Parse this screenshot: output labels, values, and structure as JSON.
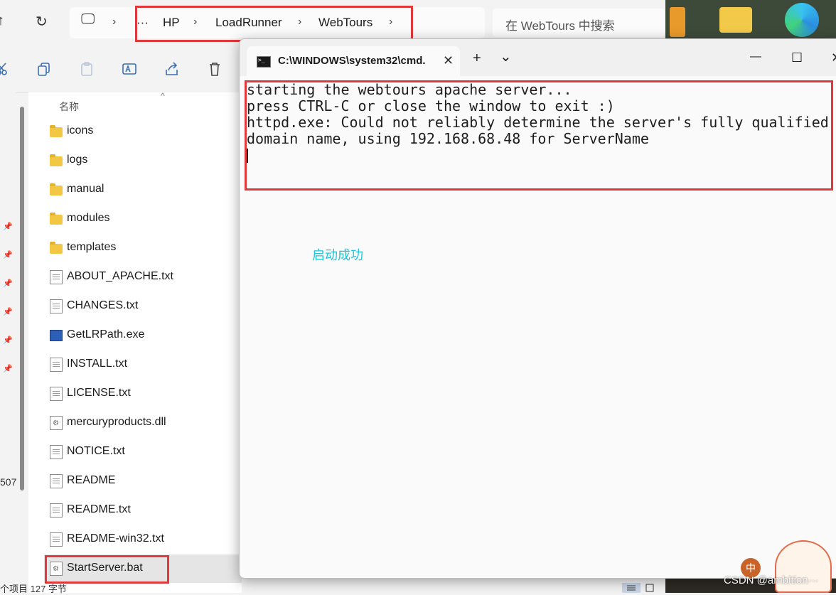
{
  "explorer": {
    "breadcrumb": {
      "more": "···",
      "items": [
        "HP",
        "LoadRunner",
        "WebTours"
      ]
    },
    "search_placeholder": "在 WebTours 中搜索",
    "toolbar_icons": [
      "cut-icon",
      "copy-icon",
      "paste-icon",
      "rename-icon",
      "share-icon",
      "delete-icon"
    ],
    "column_header": "名称",
    "files": [
      {
        "name": "icons",
        "type": "folder"
      },
      {
        "name": "logs",
        "type": "folder"
      },
      {
        "name": "manual",
        "type": "folder"
      },
      {
        "name": "modules",
        "type": "folder"
      },
      {
        "name": "templates",
        "type": "folder"
      },
      {
        "name": "ABOUT_APACHE.txt",
        "type": "text"
      },
      {
        "name": "CHANGES.txt",
        "type": "text"
      },
      {
        "name": "GetLRPath.exe",
        "type": "exe"
      },
      {
        "name": "INSTALL.txt",
        "type": "text"
      },
      {
        "name": "LICENSE.txt",
        "type": "text"
      },
      {
        "name": "mercuryproducts.dll",
        "type": "gear"
      },
      {
        "name": "NOTICE.txt",
        "type": "text"
      },
      {
        "name": "README",
        "type": "text"
      },
      {
        "name": "README.txt",
        "type": "text"
      },
      {
        "name": "README-win32.txt",
        "type": "text"
      },
      {
        "name": "StartServer.bat",
        "type": "gear",
        "selected": true
      }
    ],
    "status_text": "个项目  127 字节",
    "left_pane_number": "507"
  },
  "cmd": {
    "tab_title": "C:\\WINDOWS\\system32\\cmd.",
    "new_tab": "+",
    "dropdown": "⌄",
    "minimize": "—",
    "maximize": "☐",
    "close": "✕",
    "output_lines": [
      "starting the webtours apache server...",
      "press CTRL-C or close the window to exit :)",
      "httpd.exe: Could not reliably determine the server's fully qualified",
      "domain name, using 192.168.68.48 for ServerName"
    ]
  },
  "annotation": "启动成功",
  "overlay": {
    "ime_badge": "中",
    "watermark": "CSDN @ambition···"
  },
  "colors": {
    "highlight_red": "#e0393b",
    "annotation_cyan": "#22c3d6"
  }
}
